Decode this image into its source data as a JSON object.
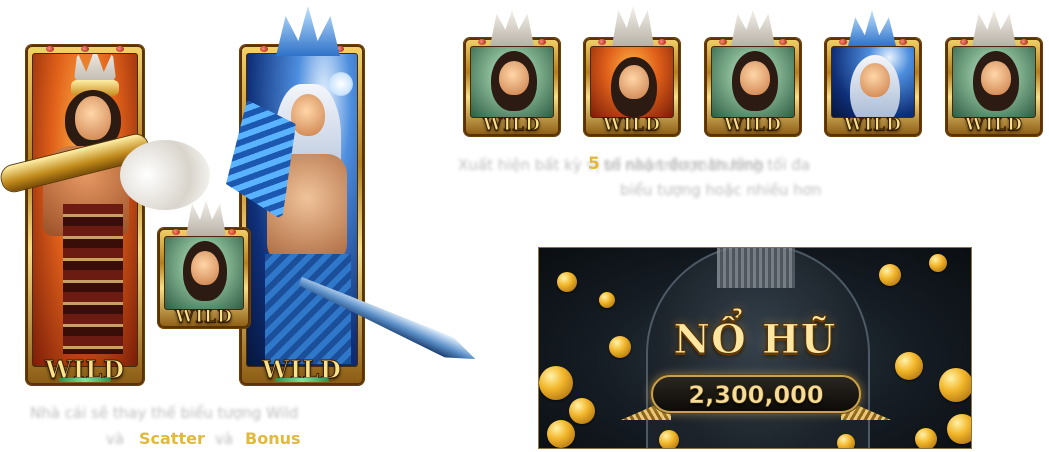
{
  "left_symbols": {
    "warrior_label": "WILD",
    "ice_label": "WILD",
    "small_label": "WILD",
    "caption_line1": "Nhà cái sẽ thay thế biểu tượng Wild",
    "caption_scatter": "Scatter",
    "caption_bonus": "Bonus",
    "caption_pre": "và",
    "caption_mid": "và"
  },
  "right_row": {
    "labels": [
      "WILD",
      "WILD",
      "WILD",
      "WILD",
      "WILD"
    ],
    "highlight_number": "5",
    "caption_line1a": "Xuất hiện bất kỳ vị trí nào trên màn hình",
    "caption_line1b": "sẽ nhận được thưởng tối đa",
    "caption_line2": "biểu tượng hoặc nhiều hơn"
  },
  "jackpot": {
    "title": "NỔ HŨ",
    "amount": "2,300,000"
  },
  "colors": {
    "highlight": "#e2b93b",
    "frame_gold": "#c98f22",
    "banner_bg": "#141b22"
  }
}
